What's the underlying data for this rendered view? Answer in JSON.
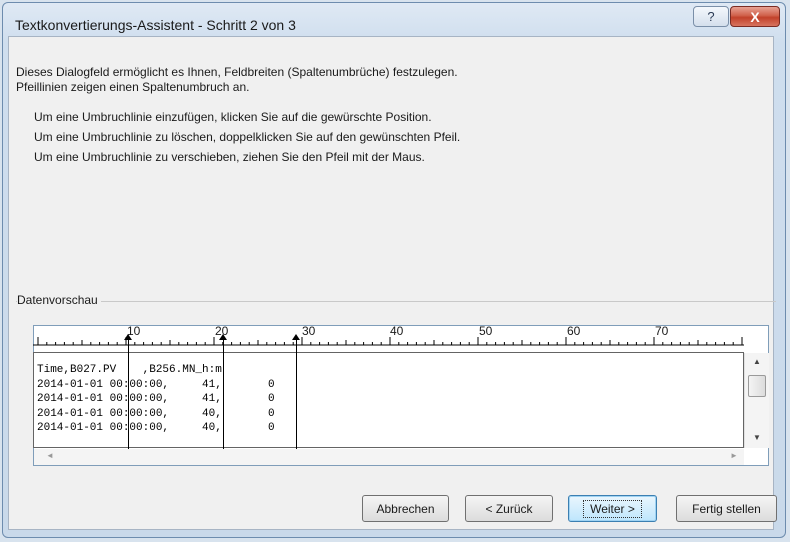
{
  "window": {
    "title": "Textkonvertierungs-Assistent - Schritt 2 von 3",
    "help_label": "?",
    "close_label": "X"
  },
  "description": {
    "line1": "Dieses Dialogfeld ermöglicht es Ihnen, Feldbreiten (Spaltenumbrüche) festzulegen.",
    "line2": "Pfeillinien zeigen einen Spaltenumbruch an."
  },
  "instructions": [
    "Um eine Umbruchlinie einzufügen, klicken Sie auf die gewürschte Position.",
    "Um eine Umbruchlinie zu löschen, doppelklicken Sie auf den gewünschten Pfeil.",
    "Um eine Umbruchlinie zu verschieben, ziehen Sie den Pfeil mit der Maus."
  ],
  "preview": {
    "label": "Datenvorschau",
    "ruler_ticks": [
      "10",
      "20",
      "30",
      "40",
      "50",
      "60",
      "70"
    ],
    "rows": [
      "Time,B027.PV    ,B256.MN_h:m",
      "2014-01-01 00:00:00,     41,       0",
      "2014-01-01 00:00:00,     41,       0",
      "2014-01-01 00:00:00,     40,       0",
      "2014-01-01 00:00:00,     40,       0"
    ]
  },
  "buttons": {
    "cancel": "Abbrechen",
    "back": "< Zurück",
    "next": "Weiter >",
    "finish": "Fertig stellen"
  },
  "scroll": {
    "up": "▲",
    "down": "▼",
    "left": "◄",
    "right": "►"
  }
}
